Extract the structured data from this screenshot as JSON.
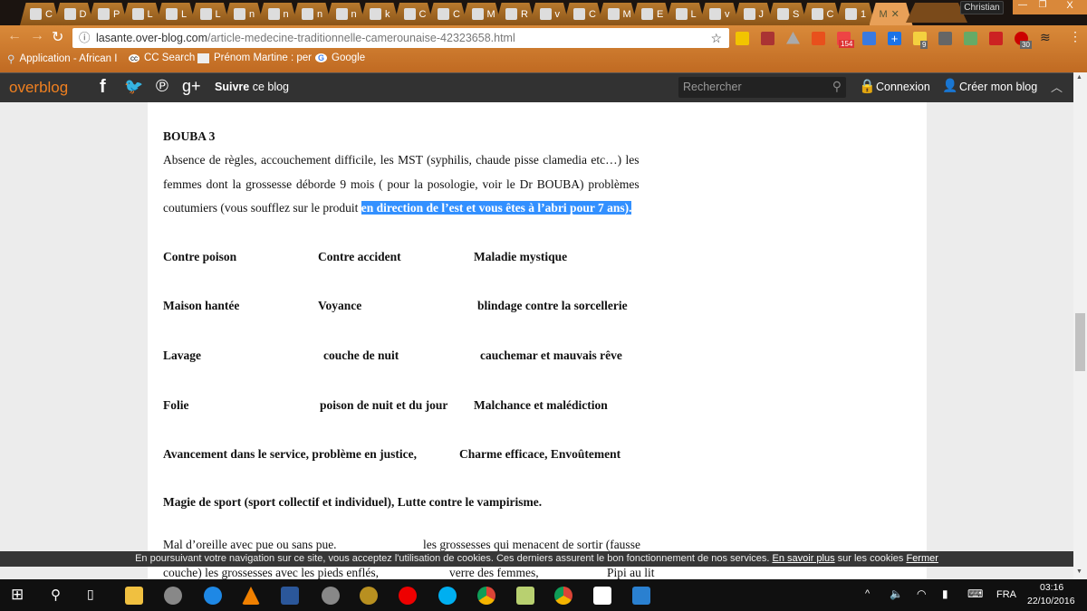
{
  "browser": {
    "tabs": [
      "C",
      "D",
      "P",
      "L",
      "L",
      "L",
      "n",
      "n",
      "n",
      "n",
      "k",
      "C",
      "C",
      "M",
      "R",
      "v",
      "C",
      "M",
      "E",
      "L",
      "v",
      "J",
      "S",
      "C",
      "1",
      "M"
    ],
    "active_tab_index": 25,
    "profile": "Christian",
    "url_host": "lasante.over-blog.com",
    "url_path": "/article-medecine-traditionnelle-camerounaise-42323658.html",
    "badges": {
      "mail": "154",
      "todo": "9",
      "abp": "30"
    },
    "bookmarks": [
      "Application - African I",
      "CC Search",
      "Prénom Martine : per",
      "Google"
    ]
  },
  "overblog": {
    "logo": "overblog",
    "follow_bold": "Suivre",
    "follow_rest": " ce blog",
    "search_placeholder": "Rechercher",
    "login": "Connexion",
    "create": "Créer mon blog"
  },
  "article": {
    "heading": "BOUBA 3",
    "p1": "Absence de règles, accouchement difficile, les MST (syphilis, chaude pisse clamedia etc…) les",
    "p2": "femmes dont la grossesse déborde 9 mois ( pour la posologie, voir le Dr BOUBA) problèmes",
    "p3": "coutumiers (vous soufflez sur le produit ",
    "p3_selected": "en direction de l’est et vous êtes à l’abri pour 7 ans).",
    "grid": [
      [
        "Contre poison",
        "Contre accident",
        "Maladie mystique"
      ],
      [
        "Maison hantée",
        "Voyance",
        "blindage contre la sorcellerie"
      ],
      [
        "Lavage",
        "couche de nuit",
        "cauchemar et mauvais rêve"
      ],
      [
        "Folie",
        "poison de nuit et du jour",
        "Malchance et malédiction"
      ]
    ],
    "line5a": "Avancement dans le service, problème en justice,",
    "line5b": "Charme efficace, Envoûtement",
    "line6": "Magie de sport (sport collectif et individuel), Lutte contre le vampirisme.",
    "line7a": "Mal d’oreille avec pue ou sans pue.",
    "line7b": "les grossesses qui menacent de sortir (fausse",
    "line8a": "couche)   les grossesses avec les pieds enflés,",
    "line8b": "verre des femmes,",
    "line8c": "Pipi au lit"
  },
  "cookie": {
    "text": "En poursuivant votre navigation sur ce site, vous acceptez l'utilisation de cookies. Ces derniers assurent le bon fonctionnement de nos services. ",
    "link": "En savoir plus",
    "after": " sur les cookies ",
    "close": "Fermer"
  },
  "taskbar": {
    "lang": "FRA",
    "time": "03:16",
    "date": "22/10/2016"
  }
}
